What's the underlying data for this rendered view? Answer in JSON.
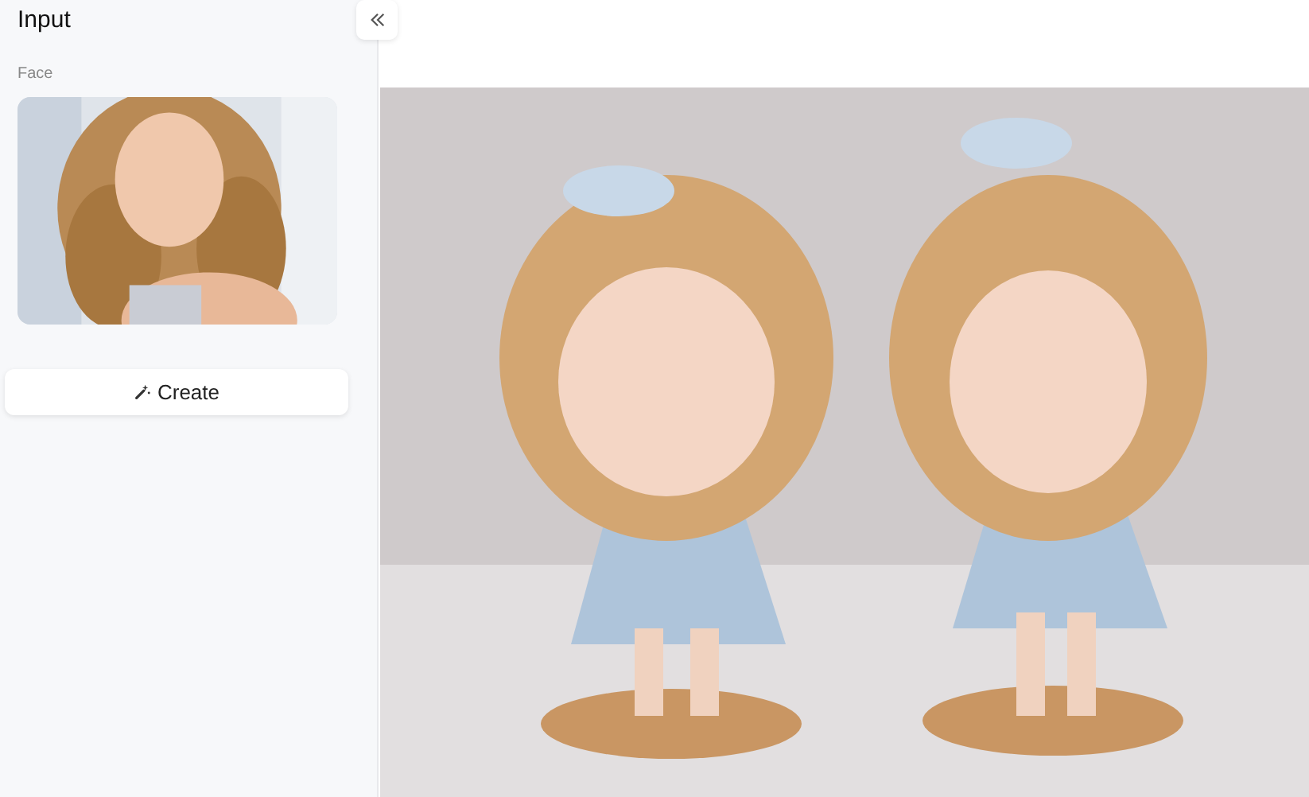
{
  "sidebar": {
    "title": "Input",
    "face_label": "Face",
    "create_button": "Create"
  }
}
